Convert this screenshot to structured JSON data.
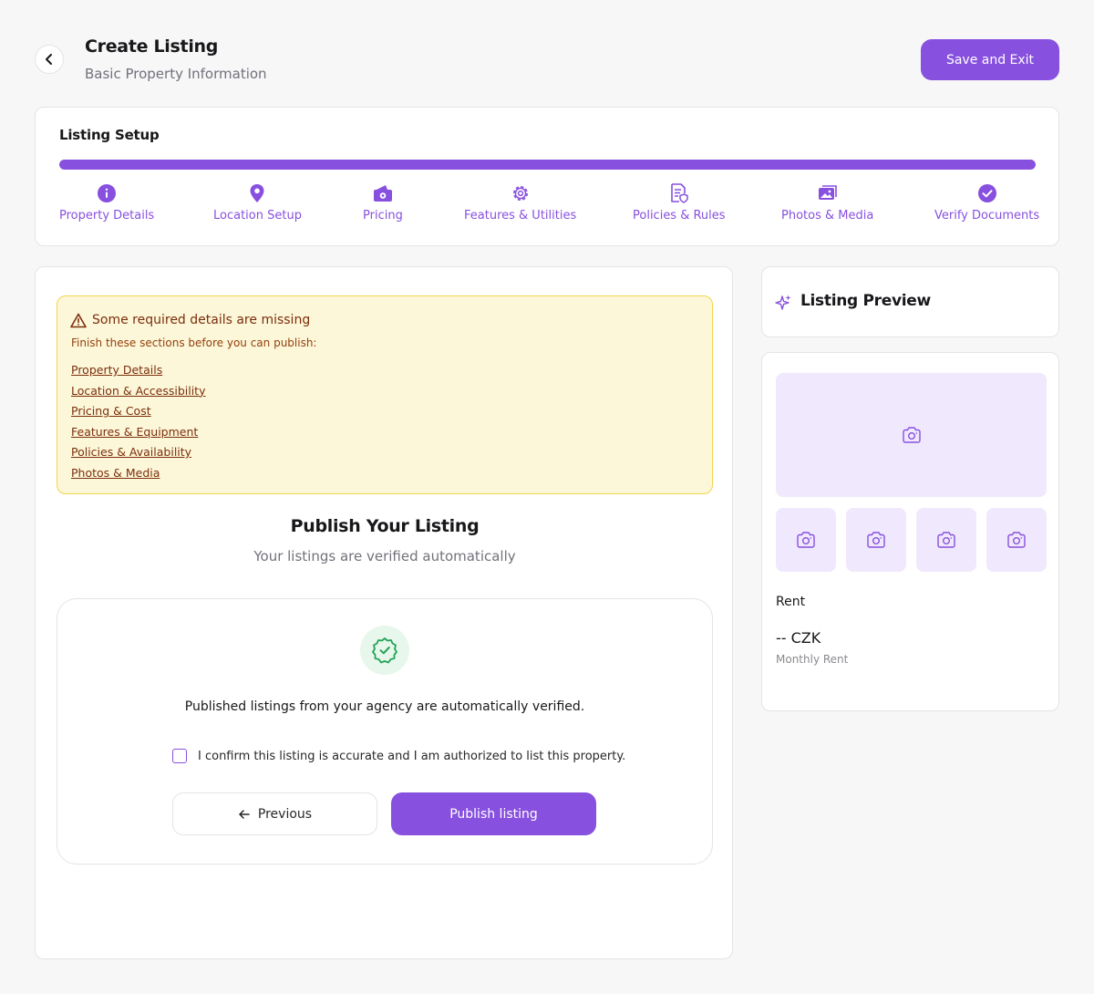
{
  "header": {
    "title": "Create Listing",
    "subtitle": "Basic Property Information",
    "save_label": "Save and Exit"
  },
  "setup": {
    "title": "Listing Setup",
    "progress_percent": 100,
    "steps": [
      {
        "label": "Property Details",
        "icon": "info-icon"
      },
      {
        "label": "Location Setup",
        "icon": "location-pin-icon"
      },
      {
        "label": "Pricing",
        "icon": "money-icon"
      },
      {
        "label": "Features & Utilities",
        "icon": "gear-icon"
      },
      {
        "label": "Policies & Rules",
        "icon": "policy-document-icon"
      },
      {
        "label": "Photos & Media",
        "icon": "photo-gallery-icon"
      },
      {
        "label": "Verify Documents",
        "icon": "check-circle-icon"
      }
    ]
  },
  "alert": {
    "title": "Some required details are missing",
    "description": "Finish these sections before you can publish:",
    "links": [
      "Property Details",
      "Location & Accessibility",
      "Pricing & Cost",
      "Features & Equipment",
      "Policies & Availability",
      "Photos & Media"
    ]
  },
  "publish": {
    "title": "Publish Your Listing",
    "subtitle": "Your listings are verified automatically",
    "verify_text": "Published listings from your agency are automatically verified.",
    "confirm_text": "I confirm this listing is accurate and I am authorized to list this property.",
    "previous_label": "Previous",
    "publish_label": "Publish listing"
  },
  "preview": {
    "title": "Listing Preview",
    "rent_label": "Rent",
    "rent_value": "-- CZK",
    "rent_period": "Monthly Rent"
  },
  "colors": {
    "accent": "#8750df",
    "warning_bg": "#fdf7d9",
    "warning_border": "#f0d64d",
    "success": "#22a356"
  }
}
